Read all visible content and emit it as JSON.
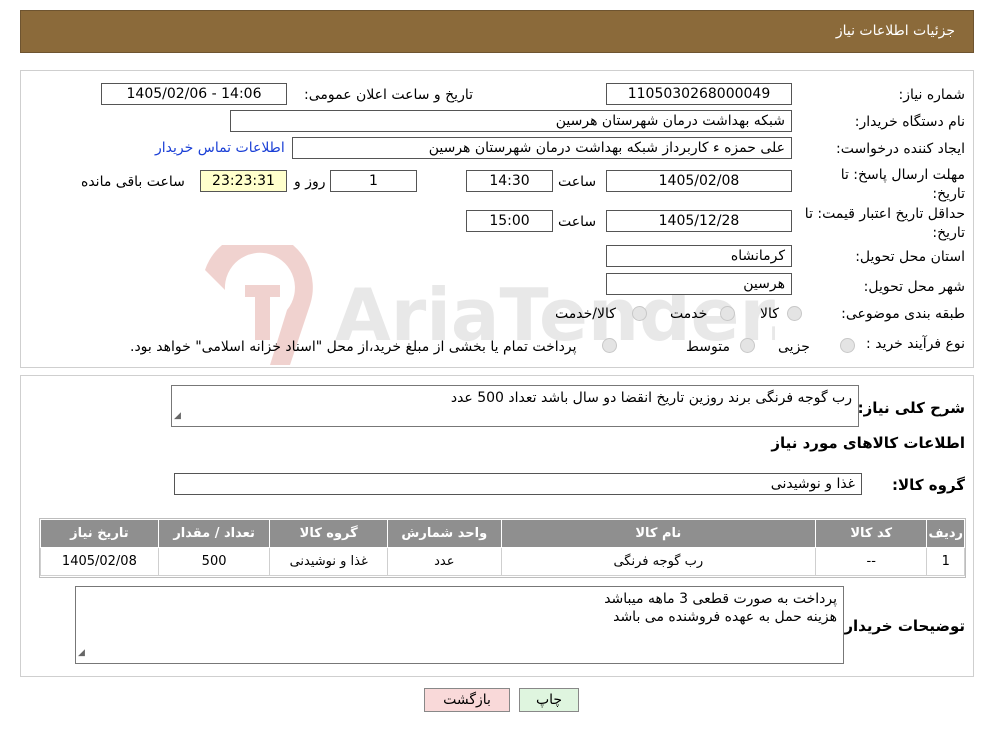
{
  "header": {
    "title": "جزئیات اطلاعات نیاز"
  },
  "form": {
    "need_number_label": "شماره نیاز:",
    "need_number": "1105030268000049",
    "announce_label": "تاریخ و ساعت اعلان عمومی:",
    "announce_value": "1405/02/06 - 14:06",
    "buyer_org_label": "نام دستگاه خریدار:",
    "buyer_org": "شبکه بهداشت درمان شهرستان هرسین",
    "creator_label": "ایجاد کننده درخواست:",
    "creator": "علی حمزه ء کاربرداز شبکه بهداشت درمان شهرستان هرسین",
    "contact_link": "اطلاعات تماس خریدار",
    "deadline_label": "مهلت ارسال پاسخ: تا تاریخ:",
    "deadline_date": "1405/02/08",
    "time_label": "ساعت",
    "deadline_time": "14:30",
    "remaining_days": "1",
    "day_and_label": "روز و",
    "remaining_time": "23:23:31",
    "remaining_label": "ساعت باقی مانده",
    "validity_label": "حداقل تاریخ اعتبار قیمت: تا تاریخ:",
    "validity_date": "1405/12/28",
    "validity_time": "15:00",
    "province_label": "استان محل تحویل:",
    "province": "کرمانشاه",
    "city_label": "شهر محل تحویل:",
    "city": "هرسین",
    "category_label": "طبقه بندی موضوعی:",
    "category_options": [
      "کالا",
      "خدمت",
      "کالا/خدمت"
    ],
    "process_label": "نوع فرآیند خرید :",
    "process_options": [
      "جزیی",
      "متوسط"
    ],
    "payment_note": "پرداخت تمام یا بخشی از مبلغ خرید،از محل \"اسناد خزانه اسلامی\" خواهد بود."
  },
  "details": {
    "summary_label": "شرح کلی نیاز:",
    "summary": "رب گوجه فرنگی برند روزین تاریخ انقضا  دو سال باشد تعداد 500 عدد",
    "items_title": "اطلاعات کالاهای مورد نیاز",
    "group_label": "گروه کالا:",
    "group_value": "غذا و نوشیدنی",
    "table": {
      "headers": [
        "ردیف",
        "کد کالا",
        "نام کالا",
        "واحد شمارش",
        "گروه کالا",
        "تعداد / مقدار",
        "تاریخ نیاز"
      ],
      "rows": [
        [
          "1",
          "--",
          "رب گوجه فرنگی",
          "عدد",
          "غذا و نوشیدنی",
          "500",
          "1405/02/08"
        ]
      ]
    },
    "buyer_notes_label": "توضیحات خریدار:",
    "buyer_notes_line1": "پرداخت به صورت قطعی 3 ماهه میباشد",
    "buyer_notes_line2": "هزینه حمل به عهده فروشنده می باشد"
  },
  "buttons": {
    "print": "چاپ",
    "back": "بازگشت"
  },
  "watermark": "AriaTender.neT",
  "colors": {
    "header_bg": "#8b6a3a",
    "link": "#1a3fd6",
    "back_btn": "#f9d9d9",
    "print_btn": "#dff5df"
  }
}
